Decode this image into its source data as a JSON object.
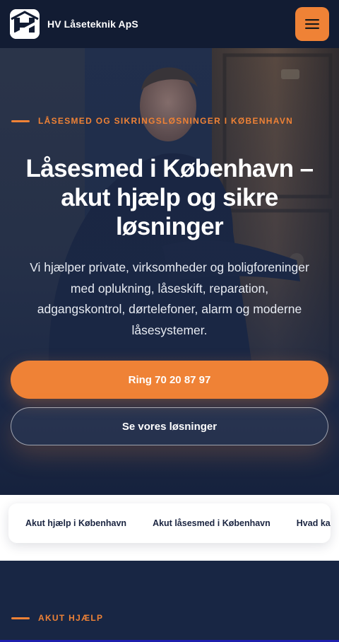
{
  "header": {
    "brand_name": "HV Låseteknik ApS",
    "logo_icon": "hv-shield-logo",
    "menu_icon": "hamburger-menu-icon"
  },
  "hero": {
    "eyebrow": "LÅSESMED OG SIKRINGSLØSNINGER I KØBENHAVN",
    "title_lines": [
      "Låsesmed i København –",
      "akut hjælp og sikre",
      "løsninger"
    ],
    "text_lines": [
      "Vi hjælper private, virksomheder og boligforeninger",
      "med oplukning, låseskift, reparation,",
      "adgangskontrol, dørtelefoner, alarm og moderne",
      "låsesystemer."
    ],
    "primary_cta": "Ring 70 20 87 97",
    "secondary_cta": "Se vores løsninger",
    "background_image": "locksmith-working-on-door"
  },
  "quicklinks": [
    "Akut hjælp i København",
    "Akut låsesmed i København",
    "Hvad kan"
  ],
  "next_section": {
    "eyebrow": "AKUT HJÆLP"
  },
  "colors": {
    "accent": "#ef8236",
    "header_bg": "#121c33",
    "section_bg": "#182644",
    "text_dark": "#1a2440"
  }
}
